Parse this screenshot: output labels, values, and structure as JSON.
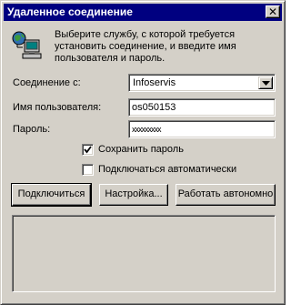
{
  "window": {
    "title": "Удаленное соединение",
    "close_glyph": "✕"
  },
  "intro": {
    "icon": "network-computer-icon",
    "text": "Выберите службу, с которой требуется\nустановить соединение, и введите имя\nпользователя и пароль."
  },
  "form": {
    "connection_label": "Соединение с:",
    "connection_value": "Infoservis",
    "username_label": "Имя пользователя:",
    "username_value": "os050153",
    "password_label": "Пароль:",
    "password_value": "xxxxxxxxx"
  },
  "options": {
    "save_password": {
      "label": "Сохранить пароль",
      "checked": true
    },
    "auto_connect": {
      "label": "Подключаться автоматически",
      "checked": false
    }
  },
  "buttons": {
    "connect": "Подключиться",
    "settings": "Настройка...",
    "offline": "Работать автономно"
  },
  "status_text": "",
  "colors": {
    "titlebar": "#000080",
    "face": "#d4d0c8"
  }
}
